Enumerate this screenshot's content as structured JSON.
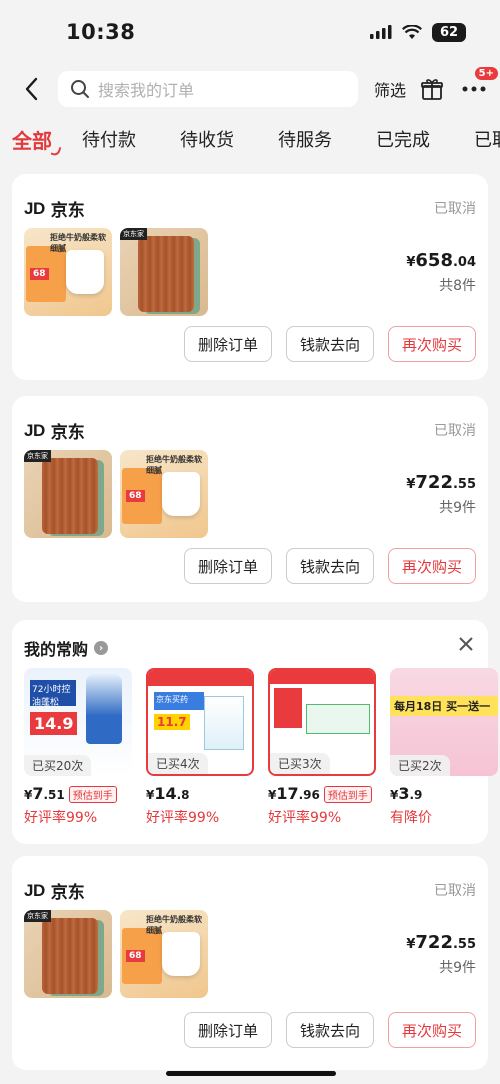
{
  "status_bar": {
    "time": "10:38",
    "battery": "62"
  },
  "nav": {
    "search_placeholder": "搜索我的订单",
    "filter_label": "筛选",
    "more_badge": "5+"
  },
  "tabs": [
    {
      "label": "全部"
    },
    {
      "label": "待付款"
    },
    {
      "label": "待收货"
    },
    {
      "label": "待服务"
    },
    {
      "label": "已完成"
    },
    {
      "label": "已取消"
    }
  ],
  "orders": [
    {
      "logo": "JD",
      "store": "京东",
      "status": "已取消",
      "price_symbol": "¥",
      "price_int": "658",
      "price_dec": ".04",
      "count": "共8件",
      "buttons": {
        "delete": "删除订单",
        "refund": "钱款去向",
        "rebuy": "再次购买"
      }
    },
    {
      "logo": "JD",
      "store": "京东",
      "status": "已取消",
      "price_symbol": "¥",
      "price_int": "722",
      "price_dec": ".55",
      "count": "共9件",
      "buttons": {
        "delete": "删除订单",
        "refund": "钱款去向",
        "rebuy": "再次购买"
      }
    },
    {
      "logo": "JD",
      "store": "京东",
      "status": "已取消",
      "price_symbol": "¥",
      "price_int": "722",
      "price_dec": ".55",
      "count": "共9件",
      "buttons": {
        "delete": "删除订单",
        "refund": "钱款去向",
        "rebuy": "再次购买"
      }
    }
  ],
  "frequent": {
    "title": "我的常购",
    "items": [
      {
        "bought": "已买20次",
        "price_int": "7",
        "price_dec": ".51",
        "tag": "预估到手",
        "rate": "好评率99%",
        "img_text_a": "72小时控油蓬松",
        "img_text_b": "14.9"
      },
      {
        "bought": "已买4次",
        "price_int": "14",
        "price_dec": ".8",
        "tag": "",
        "rate": "好评率99%",
        "img_text_a": "京东买药",
        "img_text_b": "11.7"
      },
      {
        "bought": "已买3次",
        "price_int": "17",
        "price_dec": ".96",
        "tag": "预估到手",
        "rate": "好评率99%",
        "img_text_a": "京东自营",
        "img_text_b": "自营"
      },
      {
        "bought": "已买2次",
        "price_int": "3",
        "price_dec": ".9",
        "tag": "",
        "rate": "有降价",
        "img_text_a": "每月18日 买一送一",
        "img_text_b": ""
      }
    ]
  },
  "thumb_labels": {
    "wood_tag": "京东家",
    "milk_head": "拒绝牛奶般柔软细腻",
    "milk_price": "68"
  }
}
